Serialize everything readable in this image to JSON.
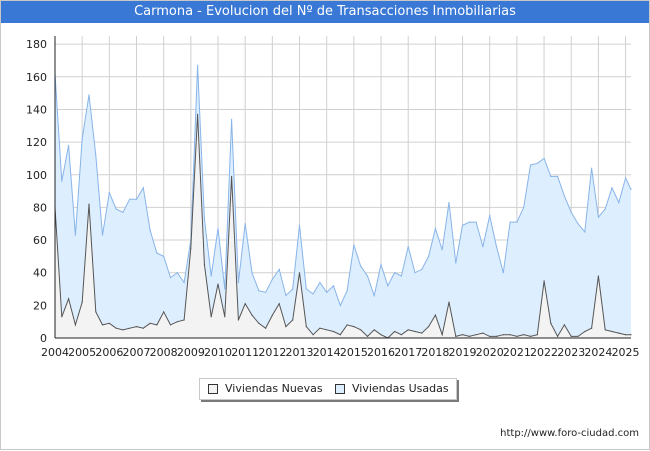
{
  "title": "Carmona - Evolucion del Nº de Transacciones Inmobiliarias",
  "source": "http://www.foro-ciudad.com",
  "colors": {
    "title_bar": "#3a78d6",
    "usadas_fill": "#ddeeff",
    "usadas_line": "#88b4e8",
    "nuevas_fill": "#f3f3f3",
    "nuevas_line": "#555555",
    "grid": "#d0d0d0"
  },
  "chart_data": {
    "type": "area",
    "title": "Carmona - Evolucion del Nº de Transacciones Inmobiliarias",
    "x_tick_labels": [
      "2004",
      "2005",
      "2006",
      "2007",
      "2008",
      "2009",
      "2010",
      "2011",
      "2012",
      "2013",
      "2014",
      "2015",
      "2016",
      "2017",
      "2018",
      "2019",
      "2020",
      "2021",
      "2022",
      "2023",
      "2024",
      "2025"
    ],
    "y_ticks": [
      0,
      20,
      40,
      60,
      80,
      100,
      120,
      140,
      160,
      180
    ],
    "ylim": [
      0,
      185
    ],
    "xlim": [
      2004,
      2025.2
    ],
    "grid": true,
    "legend": "bottom",
    "x": [
      2004.0,
      2004.25,
      2004.5,
      2004.75,
      2005.0,
      2005.25,
      2005.5,
      2005.75,
      2006.0,
      2006.25,
      2006.5,
      2006.75,
      2007.0,
      2007.25,
      2007.5,
      2007.75,
      2008.0,
      2008.25,
      2008.5,
      2008.75,
      2009.0,
      2009.25,
      2009.5,
      2009.75,
      2010.0,
      2010.25,
      2010.5,
      2010.75,
      2011.0,
      2011.25,
      2011.5,
      2011.75,
      2012.0,
      2012.25,
      2012.5,
      2012.75,
      2013.0,
      2013.25,
      2013.5,
      2013.75,
      2014.0,
      2014.25,
      2014.5,
      2014.75,
      2015.0,
      2015.25,
      2015.5,
      2015.75,
      2016.0,
      2016.25,
      2016.5,
      2016.75,
      2017.0,
      2017.25,
      2017.5,
      2017.75,
      2018.0,
      2018.25,
      2018.5,
      2018.75,
      2019.0,
      2019.25,
      2019.5,
      2019.75,
      2020.0,
      2020.25,
      2020.5,
      2020.75,
      2021.0,
      2021.25,
      2021.5,
      2021.75,
      2022.0,
      2022.25,
      2022.5,
      2022.75,
      2023.0,
      2023.25,
      2023.5,
      2023.75,
      2024.0,
      2024.25,
      2024.5,
      2024.75,
      2025.0,
      2025.2
    ],
    "series": [
      {
        "name": "Viviendas Usadas",
        "values": [
          162,
          96,
          118,
          63,
          122,
          149,
          112,
          63,
          89,
          79,
          77,
          85,
          85,
          92,
          66,
          52,
          50,
          37,
          40,
          34,
          60,
          167,
          73,
          38,
          67,
          30,
          134,
          34,
          70,
          40,
          29,
          28,
          36,
          42,
          26,
          30,
          69,
          30,
          27,
          34,
          28,
          32,
          20,
          29,
          57,
          44,
          38,
          26,
          45,
          32,
          40,
          38,
          56,
          40,
          42,
          50,
          67,
          54,
          83,
          46,
          69,
          71,
          71,
          56,
          75,
          56,
          40,
          71,
          71,
          80,
          106,
          107,
          110,
          99,
          99,
          87,
          77,
          70,
          65,
          104,
          74,
          79,
          92,
          83,
          98,
          91
        ]
      },
      {
        "name": "Viviendas Nuevas",
        "values": [
          80,
          13,
          24,
          8,
          22,
          82,
          16,
          8,
          9,
          6,
          5,
          6,
          7,
          6,
          9,
          8,
          16,
          8,
          10,
          11,
          55,
          137,
          45,
          13,
          33,
          13,
          99,
          11,
          21,
          14,
          9,
          6,
          14,
          21,
          7,
          11,
          40,
          7,
          2,
          6,
          5,
          4,
          2,
          8,
          7,
          5,
          1,
          5,
          2,
          0,
          4,
          2,
          5,
          4,
          3,
          7,
          14,
          2,
          22,
          1,
          2,
          1,
          2,
          3,
          1,
          1,
          2,
          2,
          1,
          2,
          1,
          2,
          35,
          9,
          1,
          8,
          1,
          1,
          4,
          6,
          38,
          5,
          4,
          3,
          2,
          2
        ]
      }
    ]
  },
  "legend": {
    "nuevas_label": "Viviendas Nuevas",
    "usadas_label": "Viviendas Usadas"
  }
}
